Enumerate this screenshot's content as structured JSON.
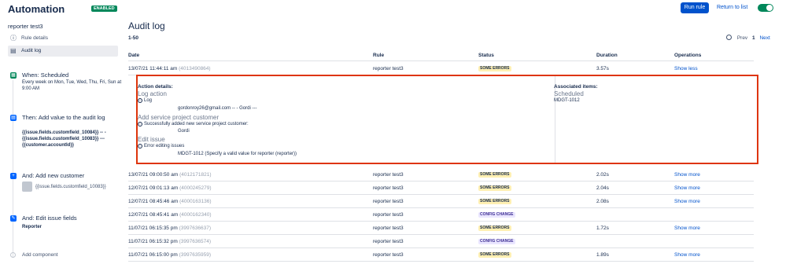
{
  "header": {
    "title": "Automation",
    "badge": "ENABLED",
    "run_button": "Run rule",
    "return_link": "Return to list"
  },
  "sidebar": {
    "rule_name": "reporter test3",
    "nav": [
      {
        "label": "Rule details",
        "icon": "info-icon"
      },
      {
        "label": "Audit log",
        "icon": "document-icon"
      }
    ],
    "components": [
      {
        "title": "When: Scheduled",
        "sub": "Every week on Mon, Tue, Wed, Thu, Fri, Sun at 9:00 AM",
        "icon": "calendar-icon",
        "color": "#00875a"
      },
      {
        "title": "Then: Add value to the audit log",
        "sub": "{{issue.fields.customfield_10084}} -- - {{issue.fields.customfield_10083}} --- {{customer.accountId}}",
        "icon": "log-icon",
        "color": "#0065ff"
      },
      {
        "title": "And: Add new customer",
        "sub": "{{issue.fields.customfield_10083}}",
        "icon": "add-customer-icon",
        "color": "#0065ff"
      },
      {
        "title": "And: Edit issue fields",
        "sub": "Reporter",
        "icon": "pencil-icon",
        "color": "#0065ff"
      }
    ],
    "add_component": "Add component"
  },
  "main": {
    "title": "Audit log",
    "range": "1-50",
    "pager": {
      "prev": "Prev",
      "current": "1",
      "next": "Next"
    },
    "columns": [
      "Date",
      "Rule",
      "Status",
      "Duration",
      "Operations"
    ],
    "first_row": {
      "date": "13/07/21 11:44:11 am",
      "id": "(4013490864)",
      "rule": "reporter test3",
      "status": "SOME ERRORS",
      "duration": "3.57s",
      "op": "Show less"
    },
    "detail": {
      "action_details": "Action details:",
      "associated_items": "Associated items:",
      "log_action": "Log action",
      "log_label": "Log",
      "log_value": "gordonroy26@gmail.com -- - Gordi ---",
      "add_customer": "Add service project customer",
      "add_customer_msg": "Successfully added new service project customer:",
      "add_customer_value": "Gordi",
      "edit_issue": "Edit issue",
      "edit_issue_msg": "Error editing issues",
      "edit_issue_value": "MDGT-1012 (Specify a valid value for reporter (reporter))",
      "scheduled": "Scheduled",
      "issue_link": "MDGT-1012"
    },
    "rows": [
      {
        "date": "13/07/21 09:00:50 am",
        "id": "(4012171821)",
        "rule": "reporter test3",
        "status": "SOME ERRORS",
        "duration": "2.02s",
        "op": "Show more"
      },
      {
        "date": "12/07/21 09:01:13 am",
        "id": "(4000245279)",
        "rule": "reporter test3",
        "status": "SOME ERRORS",
        "duration": "2.04s",
        "op": "Show more"
      },
      {
        "date": "12/07/21 08:45:46 am",
        "id": "(4000163136)",
        "rule": "reporter test3",
        "status": "SOME ERRORS",
        "duration": "2.08s",
        "op": "Show more"
      },
      {
        "date": "12/07/21 08:45:41 am",
        "id": "(4000162340)",
        "rule": "reporter test3",
        "status": "CONFIG CHANGE",
        "duration": "",
        "op": ""
      },
      {
        "date": "11/07/21 06:15:35 pm",
        "id": "(3997636637)",
        "rule": "reporter test3",
        "status": "SOME ERRORS",
        "duration": "1.72s",
        "op": "Show more"
      },
      {
        "date": "11/07/21 06:15:32 pm",
        "id": "(3997636574)",
        "rule": "reporter test3",
        "status": "CONFIG CHANGE",
        "duration": "",
        "op": ""
      },
      {
        "date": "11/07/21 06:15:00 pm",
        "id": "(3997635959)",
        "rule": "reporter test3",
        "status": "SOME ERRORS",
        "duration": "1.89s",
        "op": "Show more"
      }
    ],
    "colors": {
      "error_bg": "#fff0b3",
      "config_bg": "#eae6ff",
      "link": "#0052cc",
      "highlight_border": "#de350b"
    }
  }
}
